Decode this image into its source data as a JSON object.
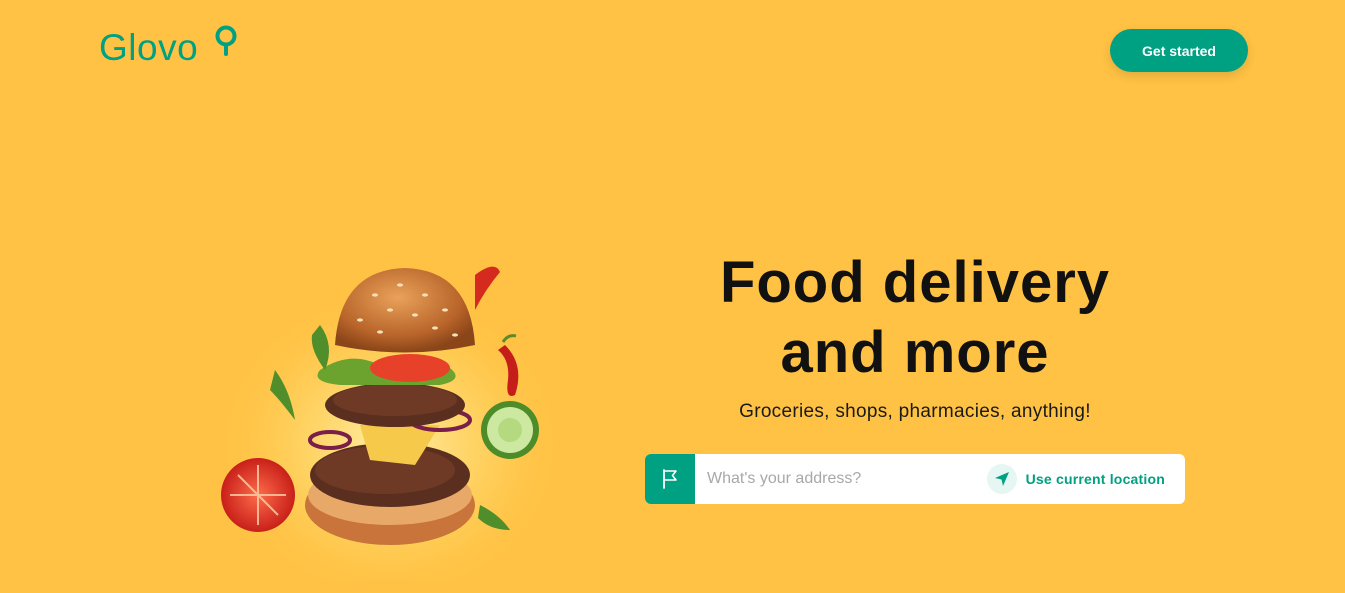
{
  "header": {
    "logo_text": "Glovo",
    "get_started_label": "Get started"
  },
  "hero": {
    "headline_line1": "Food delivery",
    "headline_line2": "and more",
    "subheadline": "Groceries, shops, pharmacies, anything!",
    "image_alt": "burger-illustration"
  },
  "address": {
    "placeholder": "What's your address?",
    "value": "",
    "use_location_label": "Use current location"
  },
  "icons": {
    "logo_pin": "map-pin-icon",
    "flag": "flag-icon",
    "location": "location-arrow-icon"
  },
  "colors": {
    "background": "#FFC244",
    "brand_green": "#00A082",
    "text_dark": "#111111"
  }
}
